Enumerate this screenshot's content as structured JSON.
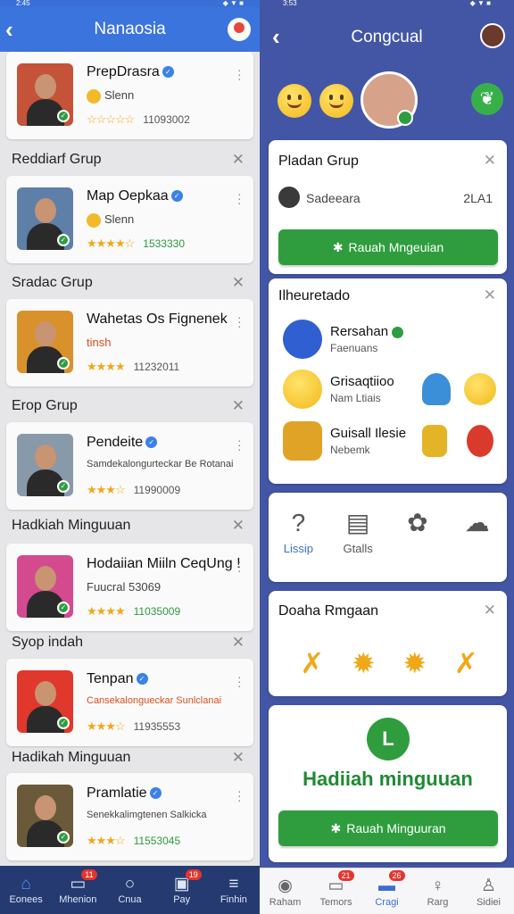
{
  "left": {
    "status": {
      "time": "2:45",
      "right": "◆ ▼ ■"
    },
    "title": "Nanaosia",
    "cards": [
      {
        "name": "PrepDrasra",
        "verified": true,
        "sub": "Slenn",
        "sub_coin": true,
        "rating": "☆☆☆☆☆",
        "number": "11093002",
        "number_green": false,
        "thumb_color": "#c4533a"
      },
      {
        "name": "Map Oepkaa",
        "verified": true,
        "sub": "Slenn",
        "sub_coin": true,
        "rating": "★★★★☆",
        "number": "1533330",
        "number_green": true,
        "thumb_color": "#5d7fa8"
      },
      {
        "name": "Wahetas Os Fignenek",
        "verified": false,
        "sub": "tinsh",
        "sub_coin": false,
        "rating": "★★★★",
        "number": "11232011",
        "number_green": false,
        "thumb_color": "#d9912c"
      },
      {
        "name": "Pendeite",
        "verified": true,
        "sub": "Samdekalongurteckar Be Rotanai",
        "sub_coin": false,
        "rating": "★★★☆",
        "number": "11990009",
        "number_green": false,
        "thumb_color": "#8899aa"
      },
      {
        "name": "Hodaiian Miiln CeqUng !",
        "verified": false,
        "sub": "Fuucral 53069",
        "sub_coin": false,
        "rating": "★★★★",
        "number": "11035009",
        "number_green": true,
        "thumb_color": "#d34a8f"
      },
      {
        "name": "Tenpan",
        "verified": true,
        "sub": "Cansekalongueckar Sunlclanai",
        "sub_coin": false,
        "rating": "★★★☆",
        "number": "11935553",
        "number_green": false,
        "thumb_color": "#e0382c"
      },
      {
        "name": "Pramlatie",
        "verified": true,
        "sub": "Senekkalimgtenen Salkicka",
        "sub_coin": false,
        "rating": "★★★☆",
        "number": "11553045",
        "number_green": true,
        "thumb_color": "#6a5a3a"
      }
    ],
    "sections": [
      "Reddiarf Grup",
      "Sradac Grup",
      "Erop Grup",
      "Hadkiah Minguuan",
      "Syop indah",
      "Hadikah Minguuan"
    ],
    "tabs": [
      {
        "label": "Eonees",
        "icon": "⌂",
        "badge": ""
      },
      {
        "label": "Mhenion",
        "icon": "▭",
        "badge": "11"
      },
      {
        "label": "Cnua",
        "icon": "○",
        "badge": ""
      },
      {
        "label": "Pay",
        "icon": "▣",
        "badge": "19"
      },
      {
        "label": "Finhin",
        "icon": "≡",
        "badge": ""
      }
    ]
  },
  "right": {
    "status": {
      "time": "3:53",
      "right": "◆ ▼ ■"
    },
    "title": "Congcual",
    "card1": {
      "title": "Pladan Grup",
      "sub": "Sadeeara",
      "value": "2LA1",
      "button": "Rauah Mngeuian"
    },
    "card2": {
      "title": "Ilheuretado",
      "people": [
        {
          "name": "Rersahan",
          "sub": "Faenuans",
          "verified": true
        },
        {
          "name": "Grisaqtiioo",
          "sub": "Nam Ltiais",
          "verified": false
        },
        {
          "name": "Guisall Ilesie",
          "sub": "Nebemk",
          "verified": false
        }
      ]
    },
    "card3": {
      "labels": [
        "Lissip",
        "Gtalls",
        "",
        ""
      ]
    },
    "card4": {
      "title": "Doaha Rmgaan"
    },
    "card5": {
      "badge": "L",
      "title": "Hadiiah minguuan",
      "button": "Rauah Minguuran"
    },
    "tabs": [
      {
        "label": "Raham",
        "icon": "◉",
        "badge": ""
      },
      {
        "label": "Temors",
        "icon": "▭",
        "badge": "21"
      },
      {
        "label": "Cragi",
        "icon": "▬",
        "badge": "26"
      },
      {
        "label": "Rarg",
        "icon": "♀",
        "badge": ""
      },
      {
        "label": "Sidiei",
        "icon": "♙",
        "badge": ""
      }
    ]
  }
}
